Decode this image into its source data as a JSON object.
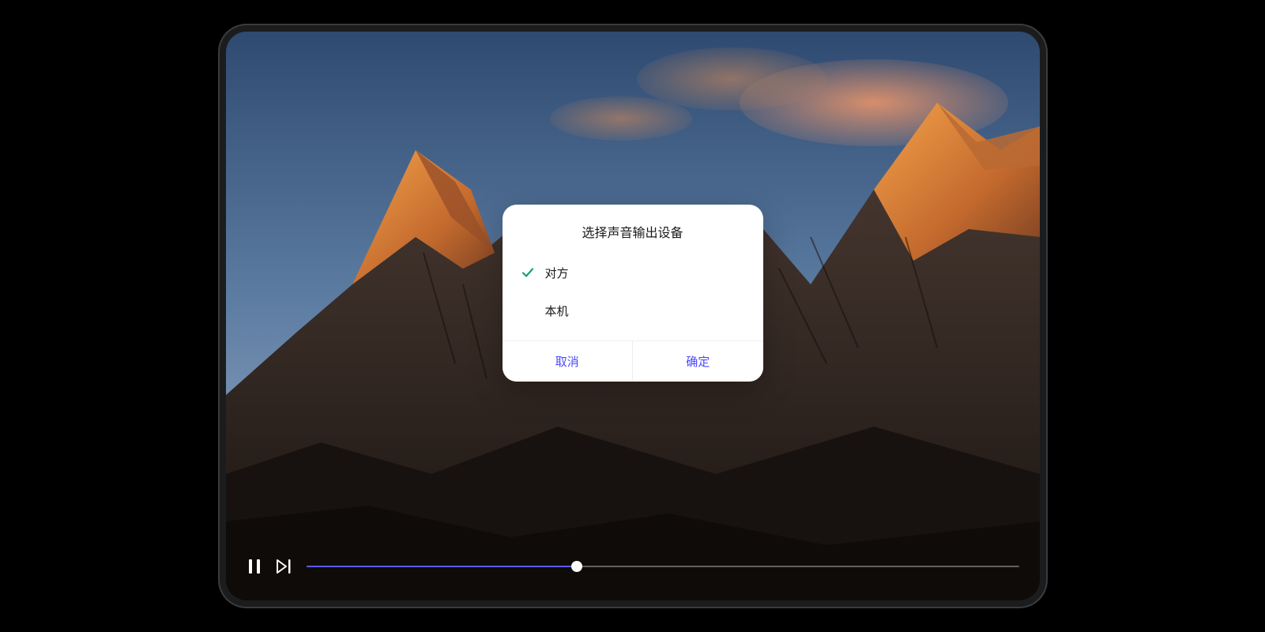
{
  "dialog": {
    "title": "选择声音输出设备",
    "options": [
      {
        "label": "对方",
        "selected": true
      },
      {
        "label": "本机",
        "selected": false
      }
    ],
    "cancel_label": "取消",
    "confirm_label": "确定"
  },
  "player": {
    "progress_percent": 38
  },
  "colors": {
    "accent": "#4a4aff",
    "check": "#1a9e78"
  }
}
